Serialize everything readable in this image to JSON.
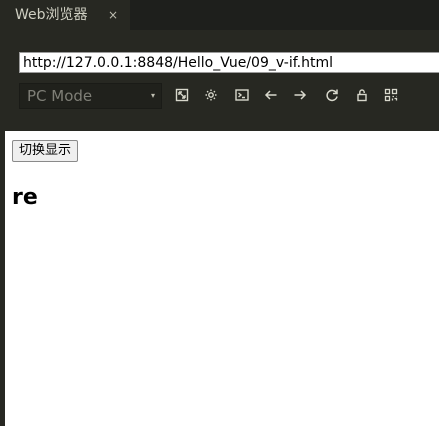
{
  "tab": {
    "title": "Web浏览器",
    "close_glyph": "×"
  },
  "address_bar": {
    "url": "http://127.0.0.1:8848/Hello_Vue/09_v-if.html"
  },
  "toolbar": {
    "mode_select": {
      "value": "PC Mode",
      "caret": "▾"
    },
    "icons": [
      "resize-icon",
      "settings-icon",
      "console-icon",
      "back-arrow-icon",
      "forward-arrow-icon",
      "refresh-icon",
      "lock-icon",
      "qr-code-icon"
    ]
  },
  "page": {
    "toggle_button_label": "切换显示",
    "heading_text": "re"
  },
  "colors": {
    "chrome_bg": "#272822",
    "tab_strip_bg": "#1e1f1c",
    "icon_color": "#d8d8cc",
    "content_bg": "#ffffff"
  }
}
